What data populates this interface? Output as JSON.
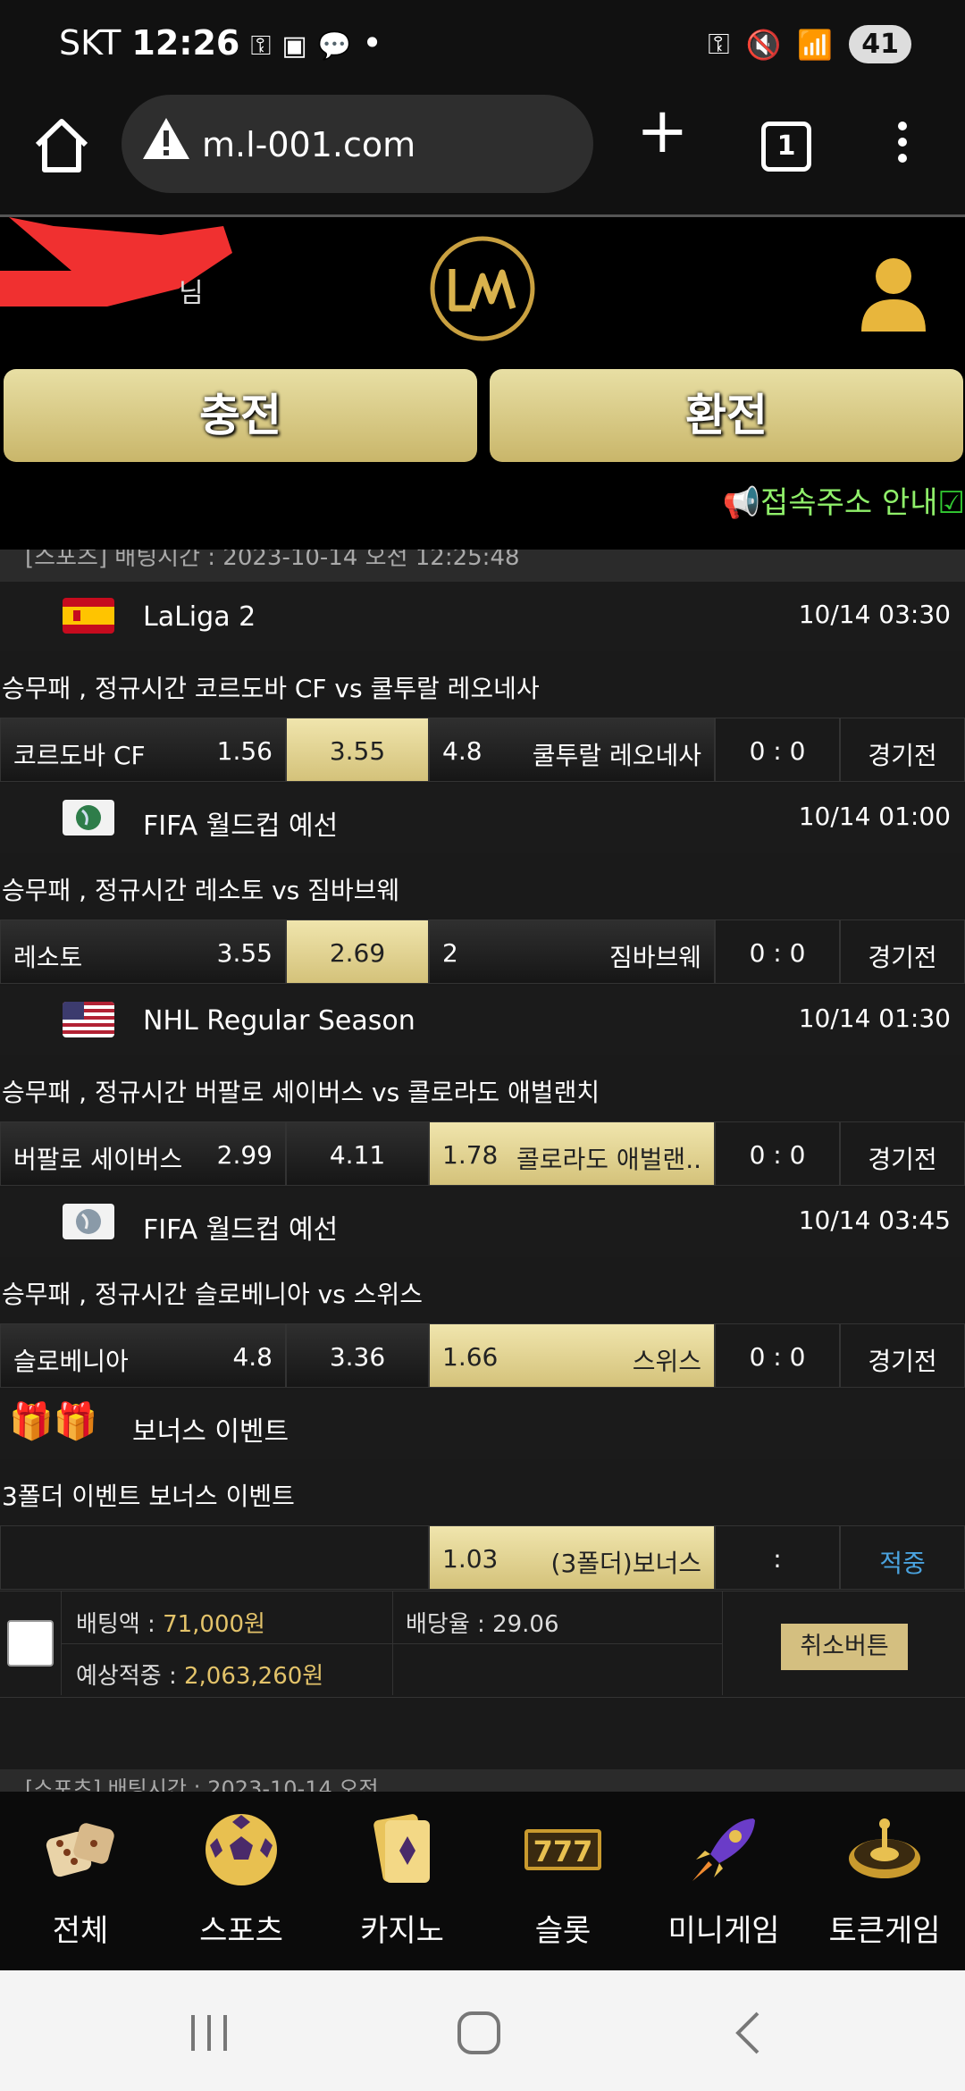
{
  "status_bar": {
    "carrier": "SKT",
    "time": "12:26",
    "battery": "41"
  },
  "browser": {
    "url": "m.l-001.com",
    "tab_count": "1"
  },
  "header": {
    "user_name": "님",
    "deposit_label": "충전",
    "withdraw_label": "환전",
    "notice": "접속주소 안내"
  },
  "partial_top_text": "[스포츠] 배팅시간 : 2023-10-14 오전 12:25:48",
  "matches": [
    {
      "league": "LaLiga 2",
      "time": "10/14 03:30",
      "title": "승무패 , 정규시간 코르도바 CF  vs  쿨투랄 레오네사",
      "home": "코르도바 CF",
      "home_odds": "1.56",
      "draw_odds": "3.55",
      "away_odds": "4.8",
      "away": "쿨투랄 레오네사",
      "score": "0 : 0",
      "status": "경기전"
    },
    {
      "league": "FIFA 월드컵 예선",
      "time": "10/14 01:00",
      "title": "승무패 , 정규시간 레소토  vs  짐바브웨",
      "home": "레소토",
      "home_odds": "3.55",
      "draw_odds": "2.69",
      "away_odds": "2",
      "away": "짐바브웨",
      "score": "0 : 0",
      "status": "경기전"
    },
    {
      "league": "NHL Regular Season",
      "time": "10/14 01:30",
      "title": "승무패 , 정규시간 버팔로 세이버스  vs  콜로라도 애벌랜치",
      "home": "버팔로 세이버스",
      "home_odds": "2.99",
      "draw_odds": "4.11",
      "away_odds": "1.78",
      "away": "콜로라도 애벌랜..",
      "score": "0 : 0",
      "status": "경기전"
    },
    {
      "league": "FIFA 월드컵 예선",
      "time": "10/14 03:45",
      "title": "승무패 , 정규시간 슬로베니아  vs  스위스",
      "home": "슬로베니아",
      "home_odds": "4.8",
      "draw_odds": "3.36",
      "away_odds": "1.66",
      "away": "스위스",
      "score": "0 : 0",
      "status": "경기전"
    }
  ],
  "bonus": {
    "league": "보너스 이벤트",
    "title": "3폴더 이벤트 보너스 이벤트",
    "odds": "1.03",
    "label": "(3폴더)보너스",
    "score": ":",
    "status": "적중"
  },
  "summary": {
    "bet_amount_label": "배팅액 : ",
    "bet_amount": "71,000원",
    "odds_label": "배당율 : ",
    "odds": "29.06",
    "expected_label": "예상적중 : ",
    "expected": "2,063,260원",
    "cancel_label": "취소버튼"
  },
  "partial_bottom_text": "[스포츠] 배팅시간 : 2023-10-14 오전",
  "bottom_nav": [
    "전체",
    "스포츠",
    "카지노",
    "슬롯",
    "미니게임",
    "토큰게임"
  ],
  "colors": {
    "gold": "#d4c27a",
    "notice_green": "#8fef6a",
    "status_blue": "#4aa3df"
  }
}
